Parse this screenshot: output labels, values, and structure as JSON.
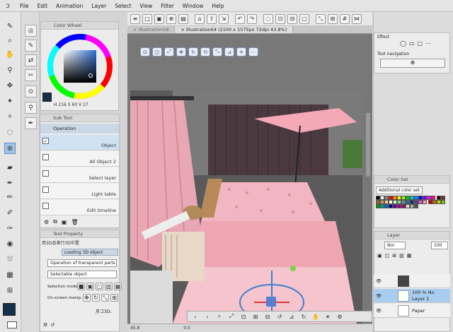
{
  "menu": {
    "items": [
      "File",
      "Edit",
      "Animation",
      "Layer",
      "Select",
      "View",
      "Filter",
      "Window",
      "Help"
    ]
  },
  "canvas": {
    "tabs": [
      "Illustration58",
      "Illustration64 (2100 x 1575px 72dpi 43.8%)"
    ],
    "status": {
      "zoom": "45.8",
      "angle": "0.0"
    }
  },
  "colorwheel": {
    "title": "Color Wheel",
    "values": [
      "216",
      "60",
      "27"
    ],
    "main_color": "#15304a"
  },
  "subtool": {
    "title": "Sub Tool",
    "group": "Operation",
    "items": [
      "Object",
      "All Object 2",
      "Select layer",
      "Light table",
      "Edit timeline"
    ]
  },
  "toolproperty": {
    "title": "Tool Property",
    "object_name": "用3D品茶行3D中置",
    "loaded_label": "Loading 3D object",
    "dropdown1": "Operation of transparent parts",
    "dropdown2": "Selectable object",
    "selection_mode_label": "Selection mode",
    "onscreen_label": "On-screen manip.",
    "bottom_text": "月コ3D、"
  },
  "right": {
    "effect_label": "Effect",
    "toolnav_label": "Tool navigation",
    "colorset_title": "Color Set",
    "colorset_name": "Additional color set",
    "layer_title": "Layer",
    "blend": "Nor",
    "opacity": "100",
    "layers": [
      {
        "name": "",
        "meta": ""
      },
      {
        "name": "Layer 1",
        "meta": "100 % No"
      },
      {
        "name": "Paper",
        "meta": ""
      }
    ]
  },
  "colors": {
    "accent": "#5e8fbf",
    "pink": "#f2b0bc",
    "dark": "#2b2b2b"
  }
}
